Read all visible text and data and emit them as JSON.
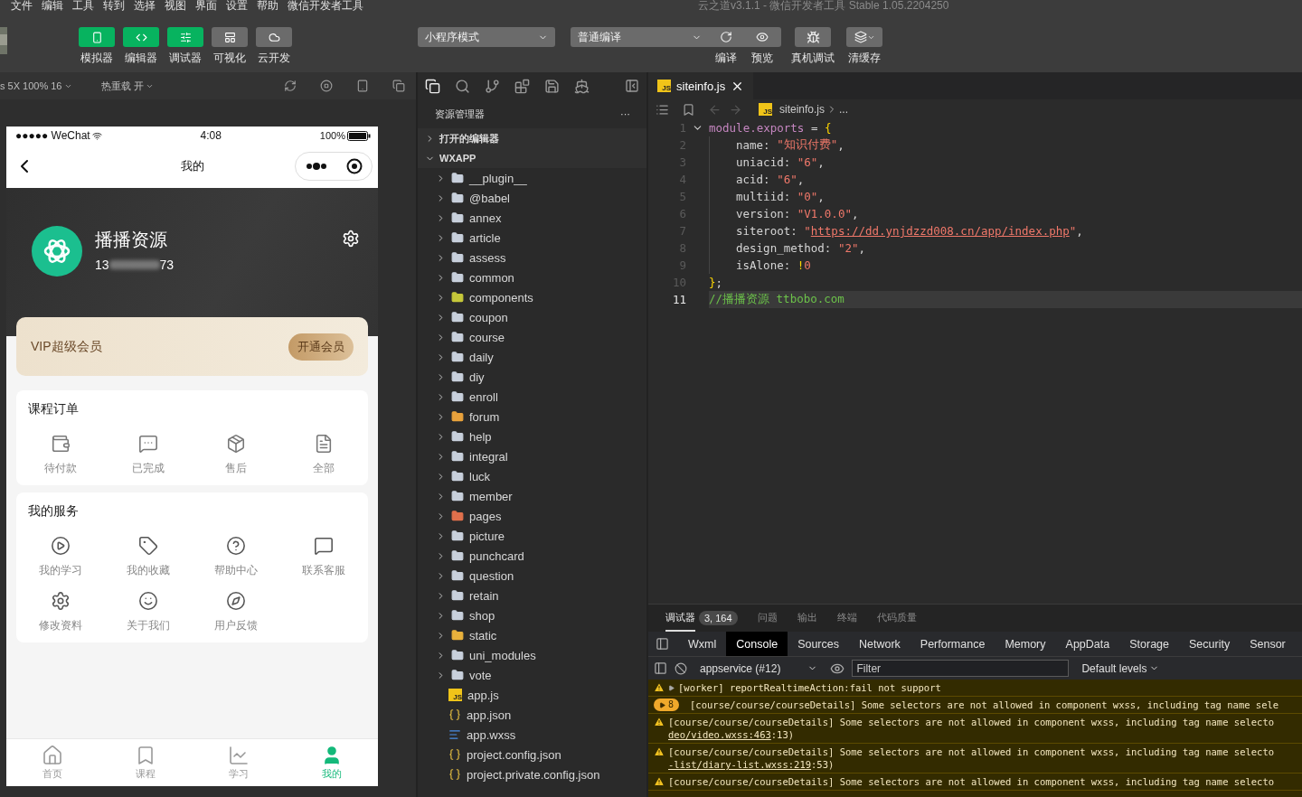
{
  "menu": [
    "文件",
    "编辑",
    "工具",
    "转到",
    "选择",
    "视图",
    "界面",
    "设置",
    "帮助",
    "微信开发者工具"
  ],
  "window_title": "云之道v3.1.1 - 微信开发者工具 Stable 1.05.2204250",
  "toolbar": {
    "view_buttons": [
      {
        "label": "模拟器",
        "on": true
      },
      {
        "label": "编辑器",
        "on": true
      },
      {
        "label": "调试器",
        "on": true
      },
      {
        "label": "可视化",
        "on": false
      },
      {
        "label": "云开发",
        "on": false
      }
    ],
    "mode_select": "小程序模式",
    "compile_select": "普通编译",
    "actions": [
      "编译",
      "预览",
      "真机调试",
      "清缓存"
    ]
  },
  "simulator_bar": {
    "device": "s 5X 100% 16",
    "hot_reload": "热重载 开"
  },
  "phone": {
    "carrier": "●●●●● WeChat",
    "time": "4:08",
    "battery": "100%",
    "title": "我的",
    "profile": {
      "name": "播播资源",
      "phone_start": "13",
      "phone_end": "73"
    },
    "vip": {
      "label": "VIP超级会员",
      "button": "开通会员"
    },
    "orders": {
      "title": "课程订单",
      "items": [
        "待付款",
        "已完成",
        "售后",
        "全部"
      ]
    },
    "services": {
      "title": "我的服务",
      "items": [
        "我的学习",
        "我的收藏",
        "帮助中心",
        "联系客服",
        "修改资料",
        "关于我们",
        "用户反馈"
      ]
    },
    "tabbar": [
      {
        "label": "首页",
        "selected": false
      },
      {
        "label": "课程",
        "selected": false
      },
      {
        "label": "学习",
        "selected": false
      },
      {
        "label": "我的",
        "selected": true
      }
    ]
  },
  "explorer": {
    "title": "资源管理器",
    "more": "···",
    "open_editors": "打开的编辑器",
    "project": "WXAPP",
    "expanded": true,
    "items": [
      {
        "name": "__plugin__",
        "kind": "folder",
        "color": "#c8d0dc"
      },
      {
        "name": "@babel",
        "kind": "folder",
        "color": "#c8d0dc"
      },
      {
        "name": "annex",
        "kind": "folder",
        "color": "#c8d0dc"
      },
      {
        "name": "article",
        "kind": "folder",
        "color": "#c8d0dc"
      },
      {
        "name": "assess",
        "kind": "folder",
        "color": "#c8d0dc"
      },
      {
        "name": "common",
        "kind": "folder",
        "color": "#c8d0dc"
      },
      {
        "name": "components",
        "kind": "folder",
        "color": "#c6c83a"
      },
      {
        "name": "coupon",
        "kind": "folder",
        "color": "#c8d0dc"
      },
      {
        "name": "course",
        "kind": "folder",
        "color": "#c8d0dc"
      },
      {
        "name": "daily",
        "kind": "folder",
        "color": "#c8d0dc"
      },
      {
        "name": "diy",
        "kind": "folder",
        "color": "#c8d0dc"
      },
      {
        "name": "enroll",
        "kind": "folder",
        "color": "#c8d0dc"
      },
      {
        "name": "forum",
        "kind": "folder",
        "color": "#e8a23c"
      },
      {
        "name": "help",
        "kind": "folder",
        "color": "#c8d0dc"
      },
      {
        "name": "integral",
        "kind": "folder",
        "color": "#c8d0dc"
      },
      {
        "name": "luck",
        "kind": "folder",
        "color": "#c8d0dc"
      },
      {
        "name": "member",
        "kind": "folder",
        "color": "#c8d0dc"
      },
      {
        "name": "pages",
        "kind": "folder",
        "color": "#e0704c"
      },
      {
        "name": "picture",
        "kind": "folder",
        "color": "#c8d0dc"
      },
      {
        "name": "punchcard",
        "kind": "folder",
        "color": "#c8d0dc"
      },
      {
        "name": "question",
        "kind": "folder",
        "color": "#c8d0dc"
      },
      {
        "name": "retain",
        "kind": "folder",
        "color": "#c8d0dc"
      },
      {
        "name": "shop",
        "kind": "folder",
        "color": "#c8d0dc"
      },
      {
        "name": "static",
        "kind": "folder",
        "color": "#e8b13c"
      },
      {
        "name": "uni_modules",
        "kind": "folder",
        "color": "#c8d0dc"
      },
      {
        "name": "vote",
        "kind": "folder",
        "color": "#c8d0dc"
      },
      {
        "name": "app.js",
        "kind": "js",
        "badge": "JS"
      },
      {
        "name": "app.json",
        "kind": "json"
      },
      {
        "name": "app.wxss",
        "kind": "wxss"
      },
      {
        "name": "project.config.json",
        "kind": "json"
      },
      {
        "name": "project.private.config.json",
        "kind": "json"
      }
    ]
  },
  "editor": {
    "tab": {
      "label": "siteinfo.js",
      "badge": "JS"
    },
    "breadcrumb": {
      "file": "siteinfo.js",
      "badge": "JS",
      "more": "..."
    },
    "lines": [
      {
        "number": "1",
        "selected": false,
        "foldable": true,
        "tokens": [
          {
            "kind": "keyword",
            "text": "module.exports"
          },
          {
            "kind": "plain",
            "text": " = "
          },
          {
            "kind": "brace",
            "text": "{"
          }
        ]
      },
      {
        "number": "2",
        "selected": false,
        "indented": true,
        "tokens": [
          {
            "kind": "plain",
            "text": "name: "
          },
          {
            "kind": "string",
            "text": "\"知识付费\""
          },
          {
            "kind": "plain",
            "text": ","
          }
        ]
      },
      {
        "number": "3",
        "selected": false,
        "indented": true,
        "tokens": [
          {
            "kind": "plain",
            "text": "uniacid: "
          },
          {
            "kind": "string",
            "text": "\"6\""
          },
          {
            "kind": "plain",
            "text": ","
          }
        ]
      },
      {
        "number": "4",
        "selected": false,
        "indented": true,
        "tokens": [
          {
            "kind": "plain",
            "text": "acid: "
          },
          {
            "kind": "string",
            "text": "\"6\""
          },
          {
            "kind": "plain",
            "text": ","
          }
        ]
      },
      {
        "number": "5",
        "selected": false,
        "indented": true,
        "tokens": [
          {
            "kind": "plain",
            "text": "multiid: "
          },
          {
            "kind": "string",
            "text": "\"0\""
          },
          {
            "kind": "plain",
            "text": ","
          }
        ]
      },
      {
        "number": "6",
        "selected": false,
        "indented": true,
        "tokens": [
          {
            "kind": "plain",
            "text": "version: "
          },
          {
            "kind": "string",
            "text": "\"V1.0.0\""
          },
          {
            "kind": "plain",
            "text": ","
          }
        ]
      },
      {
        "number": "7",
        "selected": false,
        "indented": true,
        "tokens": [
          {
            "kind": "plain",
            "text": "siteroot: "
          },
          {
            "kind": "string",
            "text": "\""
          },
          {
            "kind": "link",
            "text": "https://dd.ynjdzzd008.cn/app/index.php"
          },
          {
            "kind": "string",
            "text": "\""
          },
          {
            "kind": "plain",
            "text": ","
          }
        ]
      },
      {
        "number": "8",
        "selected": false,
        "indented": true,
        "tokens": [
          {
            "kind": "plain",
            "text": "design_method: "
          },
          {
            "kind": "string",
            "text": "\"2\""
          },
          {
            "kind": "plain",
            "text": ","
          }
        ]
      },
      {
        "number": "9",
        "selected": false,
        "indented": true,
        "tokens": [
          {
            "kind": "plain",
            "text": "isAlone: "
          },
          {
            "kind": "operator",
            "text": "!"
          },
          {
            "kind": "string",
            "text": "0"
          }
        ]
      },
      {
        "number": "10",
        "selected": false,
        "tokens": [
          {
            "kind": "brace",
            "text": "}"
          },
          {
            "kind": "plain",
            "text": ";"
          }
        ]
      },
      {
        "number": "11",
        "selected": true,
        "tokens": [
          {
            "kind": "comment",
            "text": "//播播资源 ttbobo.com"
          }
        ]
      }
    ]
  },
  "debugger": {
    "panel_tabs": [
      {
        "label": "调试器",
        "selected": true
      },
      {
        "label": "问题",
        "selected": false
      },
      {
        "label": "输出",
        "selected": false
      },
      {
        "label": "终端",
        "selected": false
      },
      {
        "label": "代码质量",
        "selected": false
      }
    ],
    "badge": "3, 164",
    "tabs": [
      {
        "label": "Wxml",
        "selected": false
      },
      {
        "label": "Console",
        "selected": true
      },
      {
        "label": "Sources",
        "selected": false
      },
      {
        "label": "Network",
        "selected": false
      },
      {
        "label": "Performance",
        "selected": false
      },
      {
        "label": "Memory",
        "selected": false
      },
      {
        "label": "AppData",
        "selected": false
      },
      {
        "label": "Storage",
        "selected": false
      },
      {
        "label": "Security",
        "selected": false
      },
      {
        "label": "Sensor",
        "selected": false
      }
    ],
    "context": "appservice (#12)",
    "filter_placeholder": "Filter",
    "levels": "Default levels",
    "messages": [
      {
        "text": "[worker] reportRealtimeAction:fail not support",
        "expandable": true
      },
      {
        "text": "[course/course/courseDetails] Some selectors are not allowed in component wxss, including tag name sele",
        "count": "8"
      },
      {
        "text": "[course/course/courseDetails] Some selectors are not allowed in component wxss, including tag name selecto",
        "link": "deo/video.wxss:463",
        "tail": ":13)"
      },
      {
        "text": "[course/course/courseDetails] Some selectors are not allowed in component wxss, including tag name selecto",
        "link": "-list/diary-list.wxss:219",
        "tail": ":53)"
      },
      {
        "text": "[course/course/courseDetails] Some selectors are not allowed in component wxss, including tag name selecto"
      }
    ]
  }
}
